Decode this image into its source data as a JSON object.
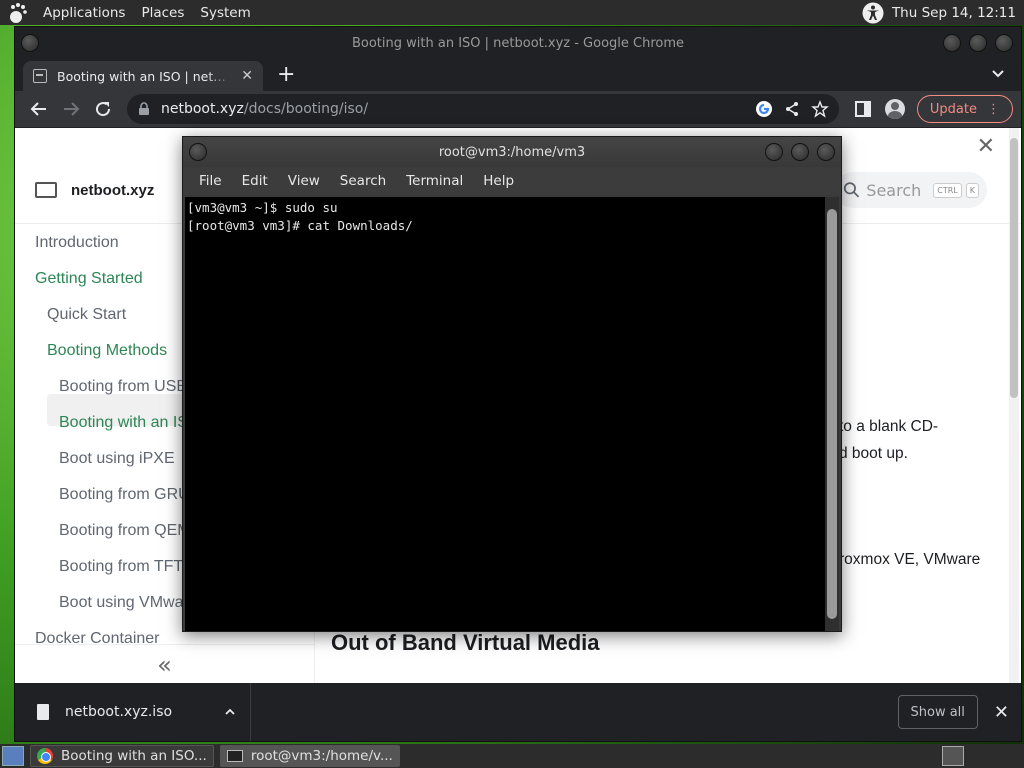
{
  "top_panel": {
    "menus": [
      "Applications",
      "Places",
      "System"
    ],
    "clock": "Thu Sep 14, 12:11"
  },
  "chrome": {
    "window_title": "Booting with an ISO | netboot.xyz - Google Chrome",
    "tab_title": "Booting with an ISO | netboot.xyz",
    "url_host": "netboot.xyz",
    "url_path": "/docs/booting/iso/",
    "update_label": "Update"
  },
  "page": {
    "site_name": "netboot.xyz",
    "search_placeholder": "Search",
    "search_keys": [
      "CTRL",
      "K"
    ],
    "sidebar": [
      {
        "label": "Introduction"
      },
      {
        "label": "Getting Started"
      },
      {
        "label": "Quick Start"
      },
      {
        "label": "Booting Methods"
      },
      {
        "label": "Booting from USB"
      },
      {
        "label": "Booting with an ISO"
      },
      {
        "label": "Boot using iPXE"
      },
      {
        "label": "Booting from GRUB"
      },
      {
        "label": "Booting from QEMU"
      },
      {
        "label": "Booting from TFTP"
      },
      {
        "label": "Boot using VMware"
      },
      {
        "label": "Docker Container"
      }
    ],
    "content_fragments": [
      "to a blank CD-",
      "d boot up.",
      "roxmox VE, VMware"
    ],
    "heading": "Out of Band Virtual Media",
    "collapse_glyph": "«"
  },
  "downloads": {
    "file_name": "netboot.xyz.iso",
    "show_all_label": "Show all"
  },
  "terminal": {
    "title": "root@vm3:/home/vm3",
    "menus": [
      "File",
      "Edit",
      "View",
      "Search",
      "Terminal",
      "Help"
    ],
    "lines": [
      "[vm3@vm3 ~]$ sudo su",
      "[root@vm3 vm3]# cat Downloads/"
    ]
  },
  "taskbar": {
    "tasks": [
      "Booting with an ISO...",
      "root@vm3:/home/v..."
    ]
  }
}
